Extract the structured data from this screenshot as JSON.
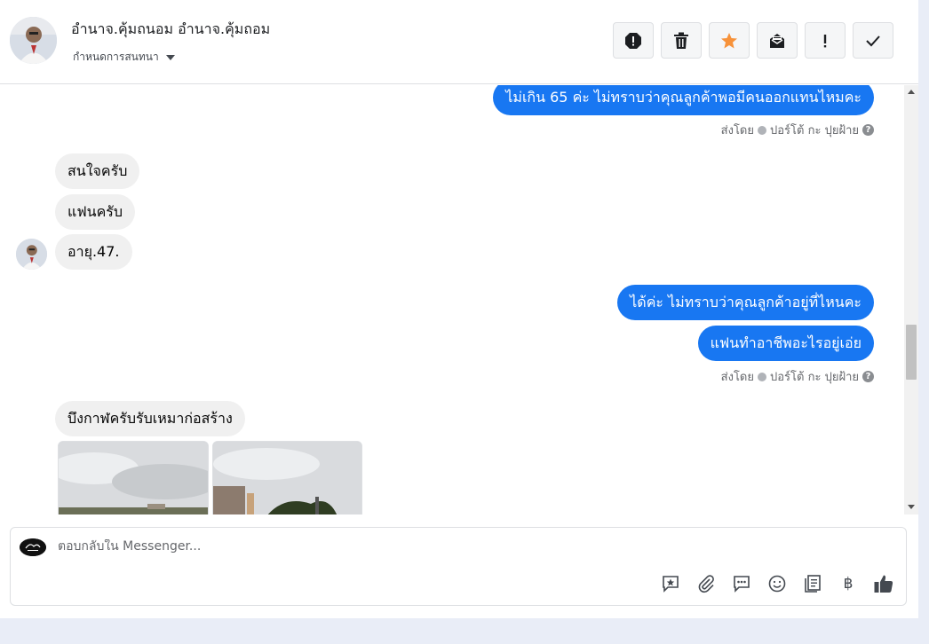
{
  "header": {
    "name": "อำนาจ.คุ้มถนอม อำนาจ.คุ้มถอม",
    "subtitle": "กำหนดการสนทนา"
  },
  "colors": {
    "accent": "#1877f2",
    "star": "#f7923a"
  },
  "actions": [
    {
      "name": "spam-icon"
    },
    {
      "name": "trash-icon"
    },
    {
      "name": "star-icon"
    },
    {
      "name": "mark-unread-icon"
    },
    {
      "name": "exclamation-icon"
    },
    {
      "name": "check-icon"
    }
  ],
  "messages": [
    {
      "side": "out",
      "text": "ไม่เกิน 65 ค่ะ ไม่ทราบว่าคุณลูกค้าพอมีคนออกแทนไหมคะ"
    },
    {
      "side": "in",
      "text": "สนใจครับ"
    },
    {
      "side": "in",
      "text": "แฟนครับ"
    },
    {
      "side": "in",
      "text": "อายุ.47."
    },
    {
      "side": "out",
      "text": "ได้ค่ะ ไม่ทราบว่าคุณลูกค้าอยู่ที่ไหนคะ"
    },
    {
      "side": "out",
      "text": "แฟนทำอาชีพอะไรอยู่เอ่ย"
    },
    {
      "side": "in",
      "text": "บึงกาฬครับรับเหมาก่อสร้าง"
    }
  ],
  "meta": {
    "sent_by_label": "ส่งโดย",
    "sender": "ปอร์โต้ กะ ปุยฝ้าย"
  },
  "composer": {
    "placeholder": "ตอบกลับใน Messenger..."
  },
  "tools": [
    {
      "name": "saved-reply-icon"
    },
    {
      "name": "attach-icon"
    },
    {
      "name": "quick-reply-icon"
    },
    {
      "name": "emoji-icon"
    },
    {
      "name": "notes-icon"
    },
    {
      "name": "baht-icon",
      "glyph": "฿"
    },
    {
      "name": "thumbs-up-icon"
    }
  ]
}
